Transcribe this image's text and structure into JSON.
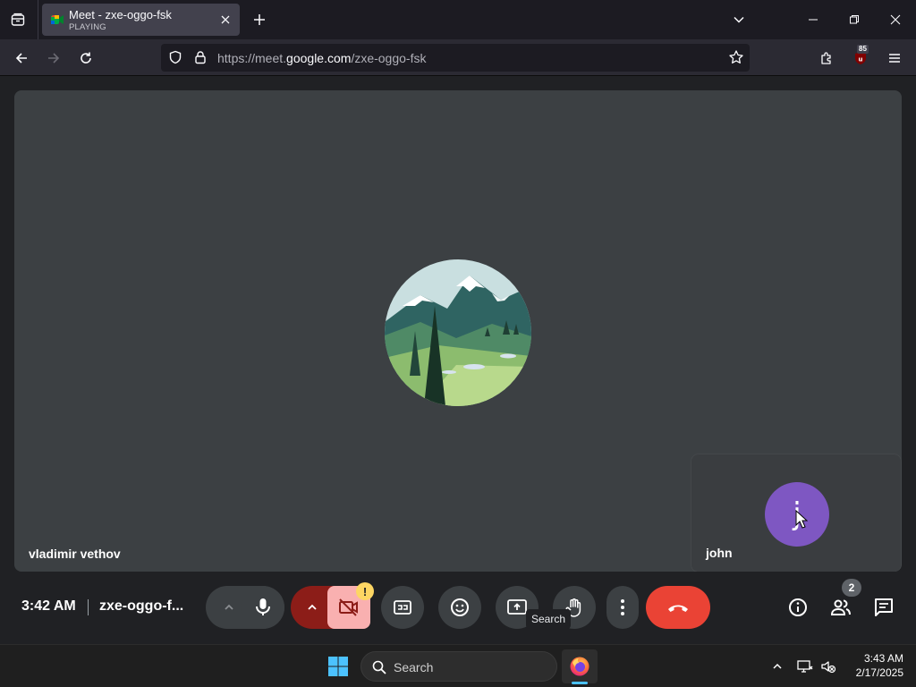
{
  "browser": {
    "tab": {
      "title": "Meet - zxe-oggo-fsk",
      "subtitle": "PLAYING"
    },
    "url": {
      "prefix": "https://meet.",
      "host": "google.com",
      "path": "/zxe-oggo-fsk"
    },
    "extension_badge": "85"
  },
  "meet": {
    "main_participant": {
      "name": "vladimir vethov"
    },
    "self_participant": {
      "name": "john",
      "initial": "j",
      "avatar_color": "#7e57c2"
    },
    "time": "3:42 AM",
    "meeting_code": "zxe-oggo-f...",
    "camera_warning": "!",
    "tooltip": "Search",
    "people_count": "2",
    "colors": {
      "end_call": "#ea4335",
      "camera_off": "#f9b0b0",
      "mic_menu": "#8c1d18"
    }
  },
  "taskbar": {
    "search_placeholder": "Search",
    "clock": {
      "time": "3:43 AM",
      "date": "2/17/2025"
    }
  }
}
